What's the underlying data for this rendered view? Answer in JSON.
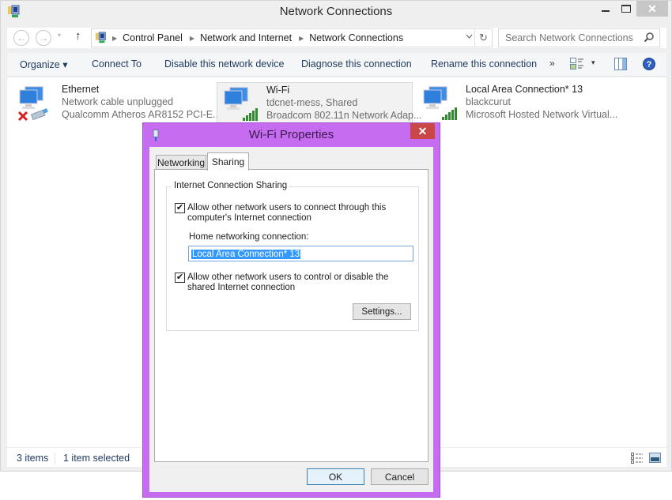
{
  "window": {
    "title": "Network Connections",
    "app_icon": "network-connections-icon",
    "controls": {
      "minimize": "–",
      "maximize": "☐",
      "close": "✕"
    }
  },
  "navigation": {
    "back": "←",
    "forward": "→",
    "recent": "▾",
    "up": "↑",
    "breadcrumb": [
      "Control Panel",
      "Network and Internet",
      "Network Connections"
    ],
    "refresh": "↻",
    "search_placeholder": "Search Network Connections"
  },
  "commandbar": {
    "organize": "Organize ▾",
    "connect_to": "Connect To",
    "disable": "Disable this network device",
    "diagnose": "Diagnose this connection",
    "rename": "Rename this connection",
    "more": "»",
    "view_dropdown": "▾"
  },
  "connections": [
    {
      "name": "Ethernet",
      "status": "Network cable unplugged",
      "device": "Qualcomm Atheros AR8152 PCI-E...",
      "state": "disconnected",
      "selected": false
    },
    {
      "name": "Wi-Fi",
      "status": "tdcnet-mess, Shared",
      "device": "Broadcom 802.11n Network Adap...",
      "state": "connected",
      "selected": true
    },
    {
      "name": "Local Area Connection* 13",
      "status": "blackcurut",
      "device": "Microsoft Hosted Network Virtual...",
      "state": "connected",
      "selected": false
    }
  ],
  "statusbar": {
    "item_count": "3 items",
    "selection": "1 item selected"
  },
  "dialog": {
    "title": "Wi-Fi Properties",
    "close": "✕",
    "tabs": [
      {
        "label": "Networking",
        "active": false
      },
      {
        "label": "Sharing",
        "active": true
      }
    ],
    "ics": {
      "group_label": "Internet Connection Sharing",
      "allow_connect": {
        "checked": true,
        "label": "Allow other network users to connect through this computer's Internet connection"
      },
      "home_connection_label": "Home networking connection:",
      "home_connection_value": "Local Area Connection* 13",
      "allow_control": {
        "checked": true,
        "label": "Allow other network users to control or disable the shared Internet connection"
      },
      "settings_button": "Settings..."
    },
    "ok_button": "OK",
    "cancel_button": "Cancel",
    "check_glyph": "✔"
  },
  "colors": {
    "dialog_frame": "#c56cf0",
    "dialog_close": "#c94747",
    "selection_highlight": "#3399ff",
    "signal_green": "#2e8b2e",
    "error_red": "#d42020"
  }
}
